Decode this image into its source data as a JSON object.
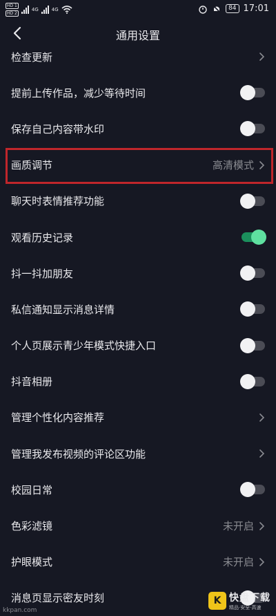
{
  "status_bar": {
    "hd_top": "HD 1",
    "hd_bottom": "HD 2",
    "net_top": "4G",
    "net_bottom": "4G",
    "battery": "84",
    "time": "17:01"
  },
  "header": {
    "title": "通用设置"
  },
  "settings": [
    {
      "label": "检查更新",
      "type": "chevron"
    },
    {
      "label": "提前上传作品，减少等待时间",
      "type": "toggle",
      "on": false
    },
    {
      "label": "保存自己内容带水印",
      "type": "toggle",
      "on": false
    },
    {
      "label": "画质调节",
      "type": "chevron",
      "value": "高清模式"
    },
    {
      "label": "聊天时表情推荐功能",
      "type": "toggle",
      "on": false
    },
    {
      "label": "观看历史记录",
      "type": "toggle",
      "on": true
    },
    {
      "label": "抖一抖加朋友",
      "type": "toggle",
      "on": false
    },
    {
      "label": "私信通知显示消息详情",
      "type": "toggle",
      "on": false
    },
    {
      "label": "个人页展示青少年模式快捷入口",
      "type": "toggle",
      "on": false
    },
    {
      "label": "抖音相册",
      "type": "toggle",
      "on": false
    },
    {
      "label": "管理个性化内容推荐",
      "type": "chevron"
    },
    {
      "label": "管理我发布视频的评论区功能",
      "type": "chevron"
    },
    {
      "label": "校园日常",
      "type": "toggle",
      "on": false
    },
    {
      "label": "色彩滤镜",
      "type": "chevron",
      "value": "未开启"
    },
    {
      "label": "护眼模式",
      "type": "chevron",
      "value": "未开启"
    },
    {
      "label": "消息页显示密友时刻",
      "type": "toggle",
      "on": false
    }
  ],
  "colors": {
    "background": "#161823",
    "highlight_border": "#c0262b",
    "toggle_on": "#5fe0a0"
  },
  "watermark": {
    "left": "kkpan.com",
    "badge": "K",
    "title": "快盘下载",
    "sub": "精品·安全·高速"
  }
}
